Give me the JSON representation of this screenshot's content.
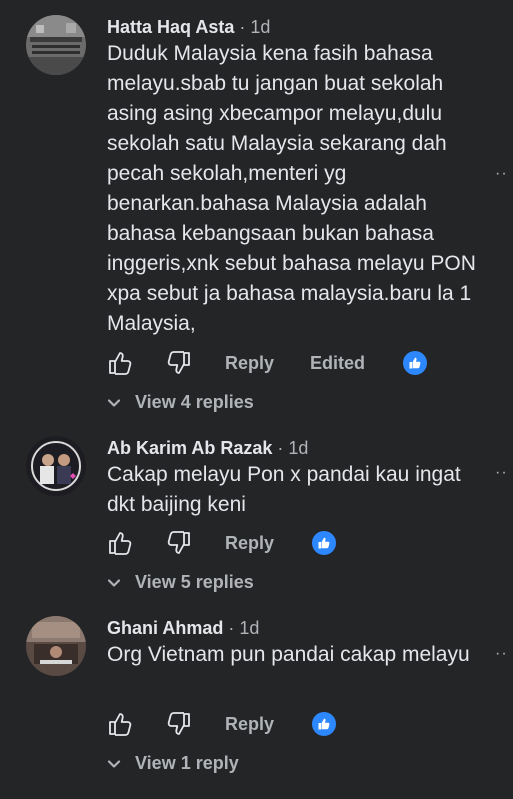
{
  "comments": [
    {
      "author": "Hatta Haq Asta",
      "separator": "·",
      "time": "1d",
      "text": "Duduk Malaysia kena fasih bahasa melayu.sbab tu jangan buat sekolah asing asing xbecampor melayu,dulu sekolah satu Malaysia sekarang dah pecah sekolah,menteri yg benarkan.bahasa Malaysia adalah bahasa kebangsaan bukan bahasa inggeris,xnk sebut bahasa melayu PON xpa sebut ja bahasa malaysia.baru la 1 Malaysia,",
      "reply_label": "Reply",
      "edited_label": "Edited",
      "reaction": "like",
      "view_replies": "View 4 replies"
    },
    {
      "author": "Ab Karim Ab Razak",
      "separator": "·",
      "time": "1d",
      "text": "Cakap melayu Pon x pandai kau ingat dkt baijing keni",
      "reply_label": "Reply",
      "reaction": "like",
      "view_replies": "View 5 replies"
    },
    {
      "author": "Ghani Ahmad",
      "separator": "·",
      "time": "1d",
      "text": "Org Vietnam pun pandai cakap melayu",
      "reply_label": "Reply",
      "reaction": "like",
      "view_replies": "View 1 reply"
    }
  ],
  "more_menu_glyph": "··",
  "colors": {
    "background": "#242526",
    "primary_text": "#e4e6eb",
    "secondary_text": "#b0b3b8",
    "like_blue": "#2d88ff"
  }
}
